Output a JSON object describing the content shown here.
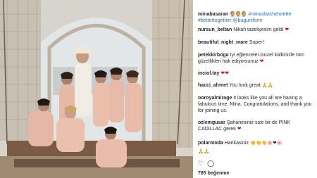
{
  "post": {
    "username": "minabasaran",
    "caption_emojis": "👰👰👰",
    "caption_text": "#minasbachelorette #bettertogether @buguniform",
    "likes": "765 beğenme"
  },
  "comments": [
    {
      "user": "nursun_beltan",
      "text": "Nikah tazeliyesim geldi",
      "emoji": "❤"
    },
    {
      "user": "beautiful_night_mare",
      "text": "Super!",
      "emoji": ""
    },
    {
      "user": "petekkirboga",
      "text": "Iyi eğlenceler.Güzel kalbinizle tüm güzellikleri hak ediyorsunuz",
      "emoji": "❤"
    },
    {
      "user": "inciol.tay",
      "text": "",
      "emoji": "❤❤"
    },
    {
      "user": "hacci_ahmet",
      "text": "You look great",
      "emoji": "🙏🙏"
    },
    {
      "user": "ooroyalmirage",
      "text": "It looks like you all are having a fabulous time. Mina. Congratulations, and thank you for joining us.",
      "emoji": ""
    },
    {
      "user": "ozlemgusar",
      "text": "Şahanesiniz size bir de PINK CADILLAC gerek",
      "emoji": "❤"
    },
    {
      "user": "polarmoda",
      "text": "Harikasiniz",
      "emoji": "👏👏👏🌸❤🌸"
    },
    {
      "user": "",
      "text": "",
      "emoji": "🙏🙏"
    }
  ],
  "actions": {
    "like_icon": "heart-outline-icon",
    "comment_icon": "comment-bubble-icon"
  },
  "colors": {
    "hashtag": "#2a6db5",
    "heart": "#d0173d",
    "robe": "#e6b9a6"
  }
}
